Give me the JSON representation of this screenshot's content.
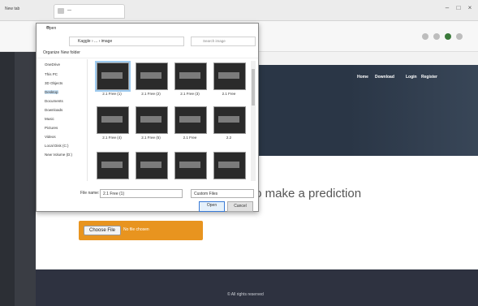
{
  "window": {
    "title": "New tab",
    "tab_title": "—"
  },
  "site": {
    "nav": [
      "Home",
      "Download",
      "Login",
      "Register"
    ],
    "heading": "to make a prediction",
    "choose_label": "Choose File",
    "no_file_text": "No file chosen",
    "footer": "© All rights reserved"
  },
  "dialog": {
    "title": "Open",
    "address": "Kaggle › ... › image",
    "search_placeholder": "Search image",
    "organize": "Organize",
    "new_folder": "New folder",
    "nav_items": [
      "OneDrive",
      "This PC",
      "3D Objects",
      "Desktop",
      "Documents",
      "Downloads",
      "Music",
      "Pictures",
      "Videos",
      "Local Disk (C:)",
      "New Volume (D:)"
    ],
    "files": [
      "2.1 Free (1)",
      "2.1 Free (2)",
      "2.1 Free (3)",
      "2.1 Free",
      "2.1 Free (4)",
      "2.1 Free (5)",
      "2.1 Free",
      "2.2",
      "",
      "",
      "",
      ""
    ],
    "filename_label": "File name:",
    "filename_value": "2.1 Free (1)",
    "filetype": "Custom Files",
    "open_label": "Open",
    "cancel_label": "Cancel"
  }
}
